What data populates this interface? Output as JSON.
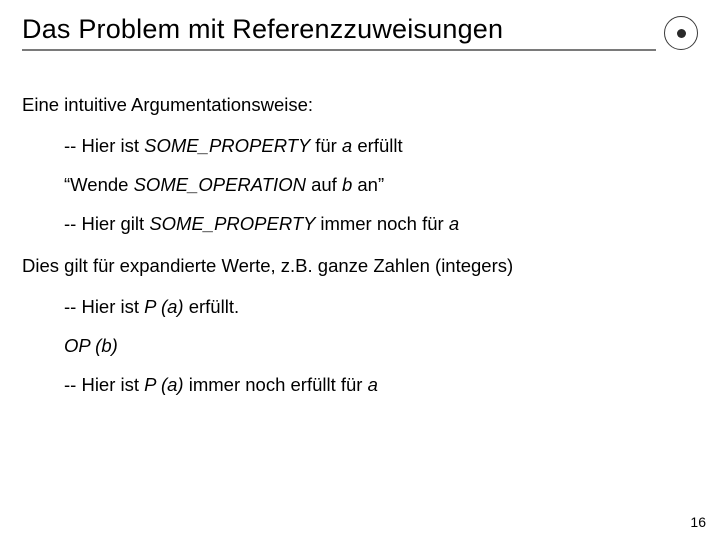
{
  "title": "Das Problem mit Referenzzuweisungen",
  "intro": "Eine intuitive Argumentationsweise:",
  "l1": {
    "p1": "-- Hier ist ",
    "p2": "SOME_PROPERTY ",
    "p3": "für ",
    "p4": "a ",
    "p5": "erfüllt"
  },
  "l2": {
    "p1": "“Wende ",
    "p2": "SOME_OPERATION ",
    "p3": "auf ",
    "p4": "b ",
    "p5": "an”"
  },
  "l3": {
    "p1": "-- Hier gilt ",
    "p2": "SOME_PROPERTY ",
    "p3": "immer noch für ",
    "p4": "a"
  },
  "bridge": "Dies gilt für expandierte Werte, z.B. ganze Zahlen (integers)",
  "l4": {
    "p1": "-- Hier ist ",
    "p2": "P (a) ",
    "p3": "erfüllt."
  },
  "l5": "OP (b)",
  "l6": {
    "p1": "-- Hier ist ",
    "p2": "P (a) ",
    "p3": "immer noch erfüllt für ",
    "p4": "a"
  },
  "page_number": "16"
}
